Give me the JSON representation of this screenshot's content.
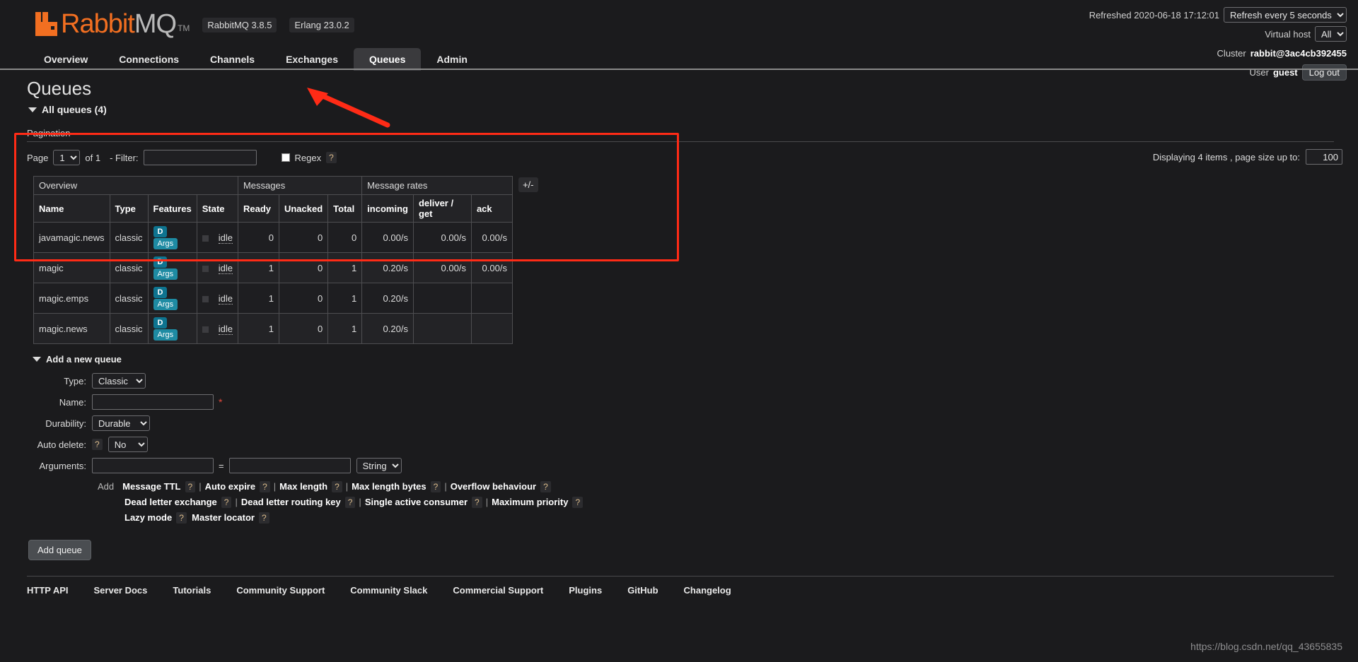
{
  "header": {
    "logo_text_primary": "Rabbit",
    "logo_text_secondary": "MQ",
    "logo_tm": "TM",
    "version_rabbitmq": "RabbitMQ 3.8.5",
    "version_erlang": "Erlang 23.0.2",
    "refreshed_label": "Refreshed 2020-06-18 17:12:01",
    "refresh_select_value": "Refresh every 5 seconds",
    "vhost_label": "Virtual host",
    "vhost_select_value": "All",
    "cluster_label": "Cluster",
    "cluster_name": "rabbit@3ac4cb392455",
    "user_label": "User",
    "user_name": "guest",
    "logout_label": "Log out"
  },
  "tabs": [
    {
      "label": "Overview",
      "active": false
    },
    {
      "label": "Connections",
      "active": false
    },
    {
      "label": "Channels",
      "active": false
    },
    {
      "label": "Exchanges",
      "active": false
    },
    {
      "label": "Queues",
      "active": true
    },
    {
      "label": "Admin",
      "active": false
    }
  ],
  "page": {
    "title": "Queues",
    "all_queues_label": "All queues (4)",
    "pagination_label": "Pagination"
  },
  "pagination": {
    "page_label": "Page",
    "page_value": "1",
    "of_label": "of 1",
    "filter_label": "- Filter:",
    "filter_value": "",
    "regex_label": "Regex",
    "regex_help": "?",
    "displaying_text": "Displaying 4 items , page size up to:",
    "page_size_value": "100"
  },
  "table": {
    "group_headers": [
      {
        "label": "Overview",
        "span": 4
      },
      {
        "label": "Messages",
        "span": 3
      },
      {
        "label": "Message rates",
        "span": 3
      }
    ],
    "columns": [
      "Name",
      "Type",
      "Features",
      "State",
      "Ready",
      "Unacked",
      "Total",
      "incoming",
      "deliver / get",
      "ack"
    ],
    "plus_minus_label": "+/-",
    "feature_badges": {
      "durable": "D",
      "args": "Args"
    },
    "rows": [
      {
        "name": "javamagic.news",
        "type": "classic",
        "features": [
          "D",
          "Args"
        ],
        "state": "idle",
        "ready": "0",
        "unacked": "0",
        "total": "0",
        "incoming": "0.00/s",
        "deliver_get": "0.00/s",
        "ack": "0.00/s"
      },
      {
        "name": "magic",
        "type": "classic",
        "features": [
          "D",
          "Args"
        ],
        "state": "idle",
        "ready": "1",
        "unacked": "0",
        "total": "1",
        "incoming": "0.20/s",
        "deliver_get": "0.00/s",
        "ack": "0.00/s"
      },
      {
        "name": "magic.emps",
        "type": "classic",
        "features": [
          "D",
          "Args"
        ],
        "state": "idle",
        "ready": "1",
        "unacked": "0",
        "total": "1",
        "incoming": "0.20/s",
        "deliver_get": "",
        "ack": ""
      },
      {
        "name": "magic.news",
        "type": "classic",
        "features": [
          "D",
          "Args"
        ],
        "state": "idle",
        "ready": "1",
        "unacked": "0",
        "total": "1",
        "incoming": "0.20/s",
        "deliver_get": "",
        "ack": ""
      }
    ]
  },
  "add_queue": {
    "section_label": "Add a new queue",
    "type_label": "Type:",
    "type_value": "Classic",
    "name_label": "Name:",
    "name_value": "",
    "required_mark": "*",
    "durability_label": "Durability:",
    "durability_value": "Durable",
    "auto_delete_label": "Auto delete:",
    "auto_delete_help": "?",
    "auto_delete_value": "No",
    "arguments_label": "Arguments:",
    "arg_key_value": "",
    "arg_equals": "=",
    "arg_val_value": "",
    "arg_type_value": "String",
    "add_word": "Add",
    "arg_links_row1": [
      "Message TTL",
      "Auto expire",
      "Max length",
      "Max length bytes",
      "Overflow behaviour"
    ],
    "arg_links_row2": [
      "Dead letter exchange",
      "Dead letter routing key",
      "Single active consumer",
      "Maximum priority"
    ],
    "arg_links_row3": [
      "Lazy mode",
      "Master locator"
    ],
    "help_mark": "?",
    "separator": "|",
    "submit_label": "Add queue"
  },
  "footer": {
    "links": [
      "HTTP API",
      "Server Docs",
      "Tutorials",
      "Community Support",
      "Community Slack",
      "Commercial Support",
      "Plugins",
      "GitHub",
      "Changelog"
    ]
  },
  "watermark": "https://blog.csdn.net/qq_43655835",
  "colors": {
    "accent_orange": "#f26f21",
    "annotation_red": "#ff2b16",
    "badge_teal": "#1e8ba3",
    "background": "#1b1b1d"
  }
}
